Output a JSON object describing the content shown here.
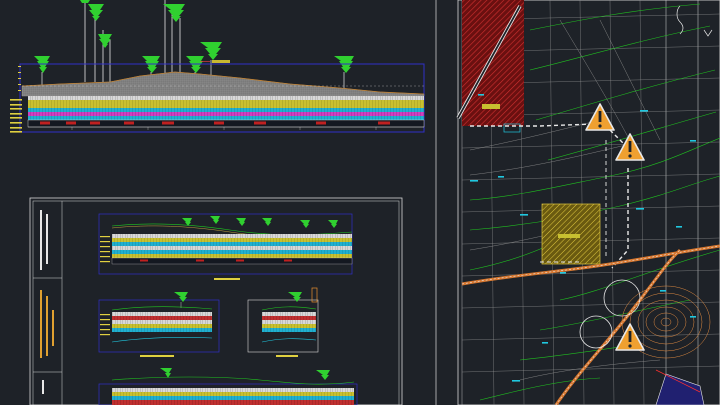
{
  "colors": {
    "background": "#1e2228",
    "frame_blue": "#3030c8",
    "tree_green": "#30d030",
    "contour_green": "#20c820",
    "red_band": "#c02020",
    "cyan": "#20c8e0",
    "yellow": "#e8e040",
    "orange": "#e87830",
    "warning_fill": "#f0a030",
    "grid_white": "#b8b8b8",
    "hatch_red": "#a01818",
    "hatch_yellow": "#c0a820"
  },
  "icons": [
    "warning-triangle-icon",
    "tree-icon",
    "north-arrow-icon"
  ],
  "top_profile": {
    "labels": [
      "",
      "",
      "",
      "",
      "",
      "",
      "",
      ""
    ],
    "tag": ""
  },
  "title_block": {
    "university": "",
    "faculty": "",
    "project": "",
    "sheet": ""
  },
  "profiles": [
    {
      "caption": ""
    },
    {
      "caption": ""
    },
    {
      "caption": ""
    }
  ],
  "plan": {
    "area_tag": "",
    "warning_count": 3
  }
}
